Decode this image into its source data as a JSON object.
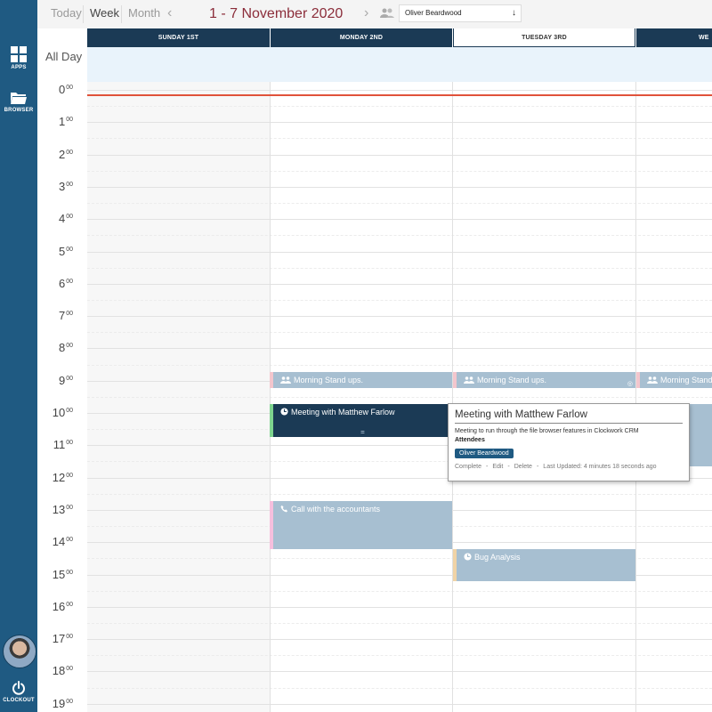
{
  "sidebar": {
    "apps_label": "APPS",
    "browser_label": "BROWSER",
    "clockout_label": "CLOCKOUT"
  },
  "toolbar": {
    "today_label": "Today",
    "week_label": "Week",
    "month_label": "Month",
    "range_title": "1 - 7 November 2020",
    "prev_icon": "‹",
    "next_icon": "›",
    "user_select_value": "Oliver Beardwood"
  },
  "days": [
    {
      "label": "SUNDAY 1ST"
    },
    {
      "label": "MONDAY 2ND"
    },
    {
      "label": "TUESDAY 3RD"
    },
    {
      "label": "WE"
    }
  ],
  "allday_label": "All Day",
  "hours": [
    {
      "h": "0",
      "m": "00"
    },
    {
      "h": "1",
      "m": "00"
    },
    {
      "h": "2",
      "m": "00"
    },
    {
      "h": "3",
      "m": "00"
    },
    {
      "h": "4",
      "m": "00"
    },
    {
      "h": "5",
      "m": "00"
    },
    {
      "h": "6",
      "m": "00"
    },
    {
      "h": "7",
      "m": "00"
    },
    {
      "h": "8",
      "m": "00"
    },
    {
      "h": "9",
      "m": "00"
    },
    {
      "h": "10",
      "m": "00"
    },
    {
      "h": "11",
      "m": "00"
    },
    {
      "h": "12",
      "m": "00"
    },
    {
      "h": "13",
      "m": "00"
    },
    {
      "h": "14",
      "m": "00"
    },
    {
      "h": "15",
      "m": "00"
    },
    {
      "h": "16",
      "m": "00"
    },
    {
      "h": "17",
      "m": "00"
    },
    {
      "h": "18",
      "m": "00"
    },
    {
      "h": "19",
      "m": "00"
    }
  ],
  "events": {
    "standup_mon": "Morning Stand ups.",
    "standup_tue": "Morning Stand ups.",
    "standup_wed": "Morning Stand u",
    "meeting": "Meeting with Matthew Farlow",
    "call": "Call with the accountants",
    "bug": "Bug Analysis"
  },
  "popup": {
    "title": "Meeting with Matthew Farlow",
    "description": "Meeting to run through the file browser features in Clockwork CRM",
    "attendees_label": "Attendees",
    "attendee": "Oliver Beardwood",
    "complete": "Complete",
    "edit": "Edit",
    "delete": "Delete",
    "last_updated": "Last Updated: 4 minutes 18 seconds ago",
    "sep": "-"
  },
  "icons": [
    "apps-grid-icon",
    "folder-icon",
    "power-icon",
    "users-icon",
    "people-icon",
    "clock-icon",
    "phone-icon"
  ]
}
